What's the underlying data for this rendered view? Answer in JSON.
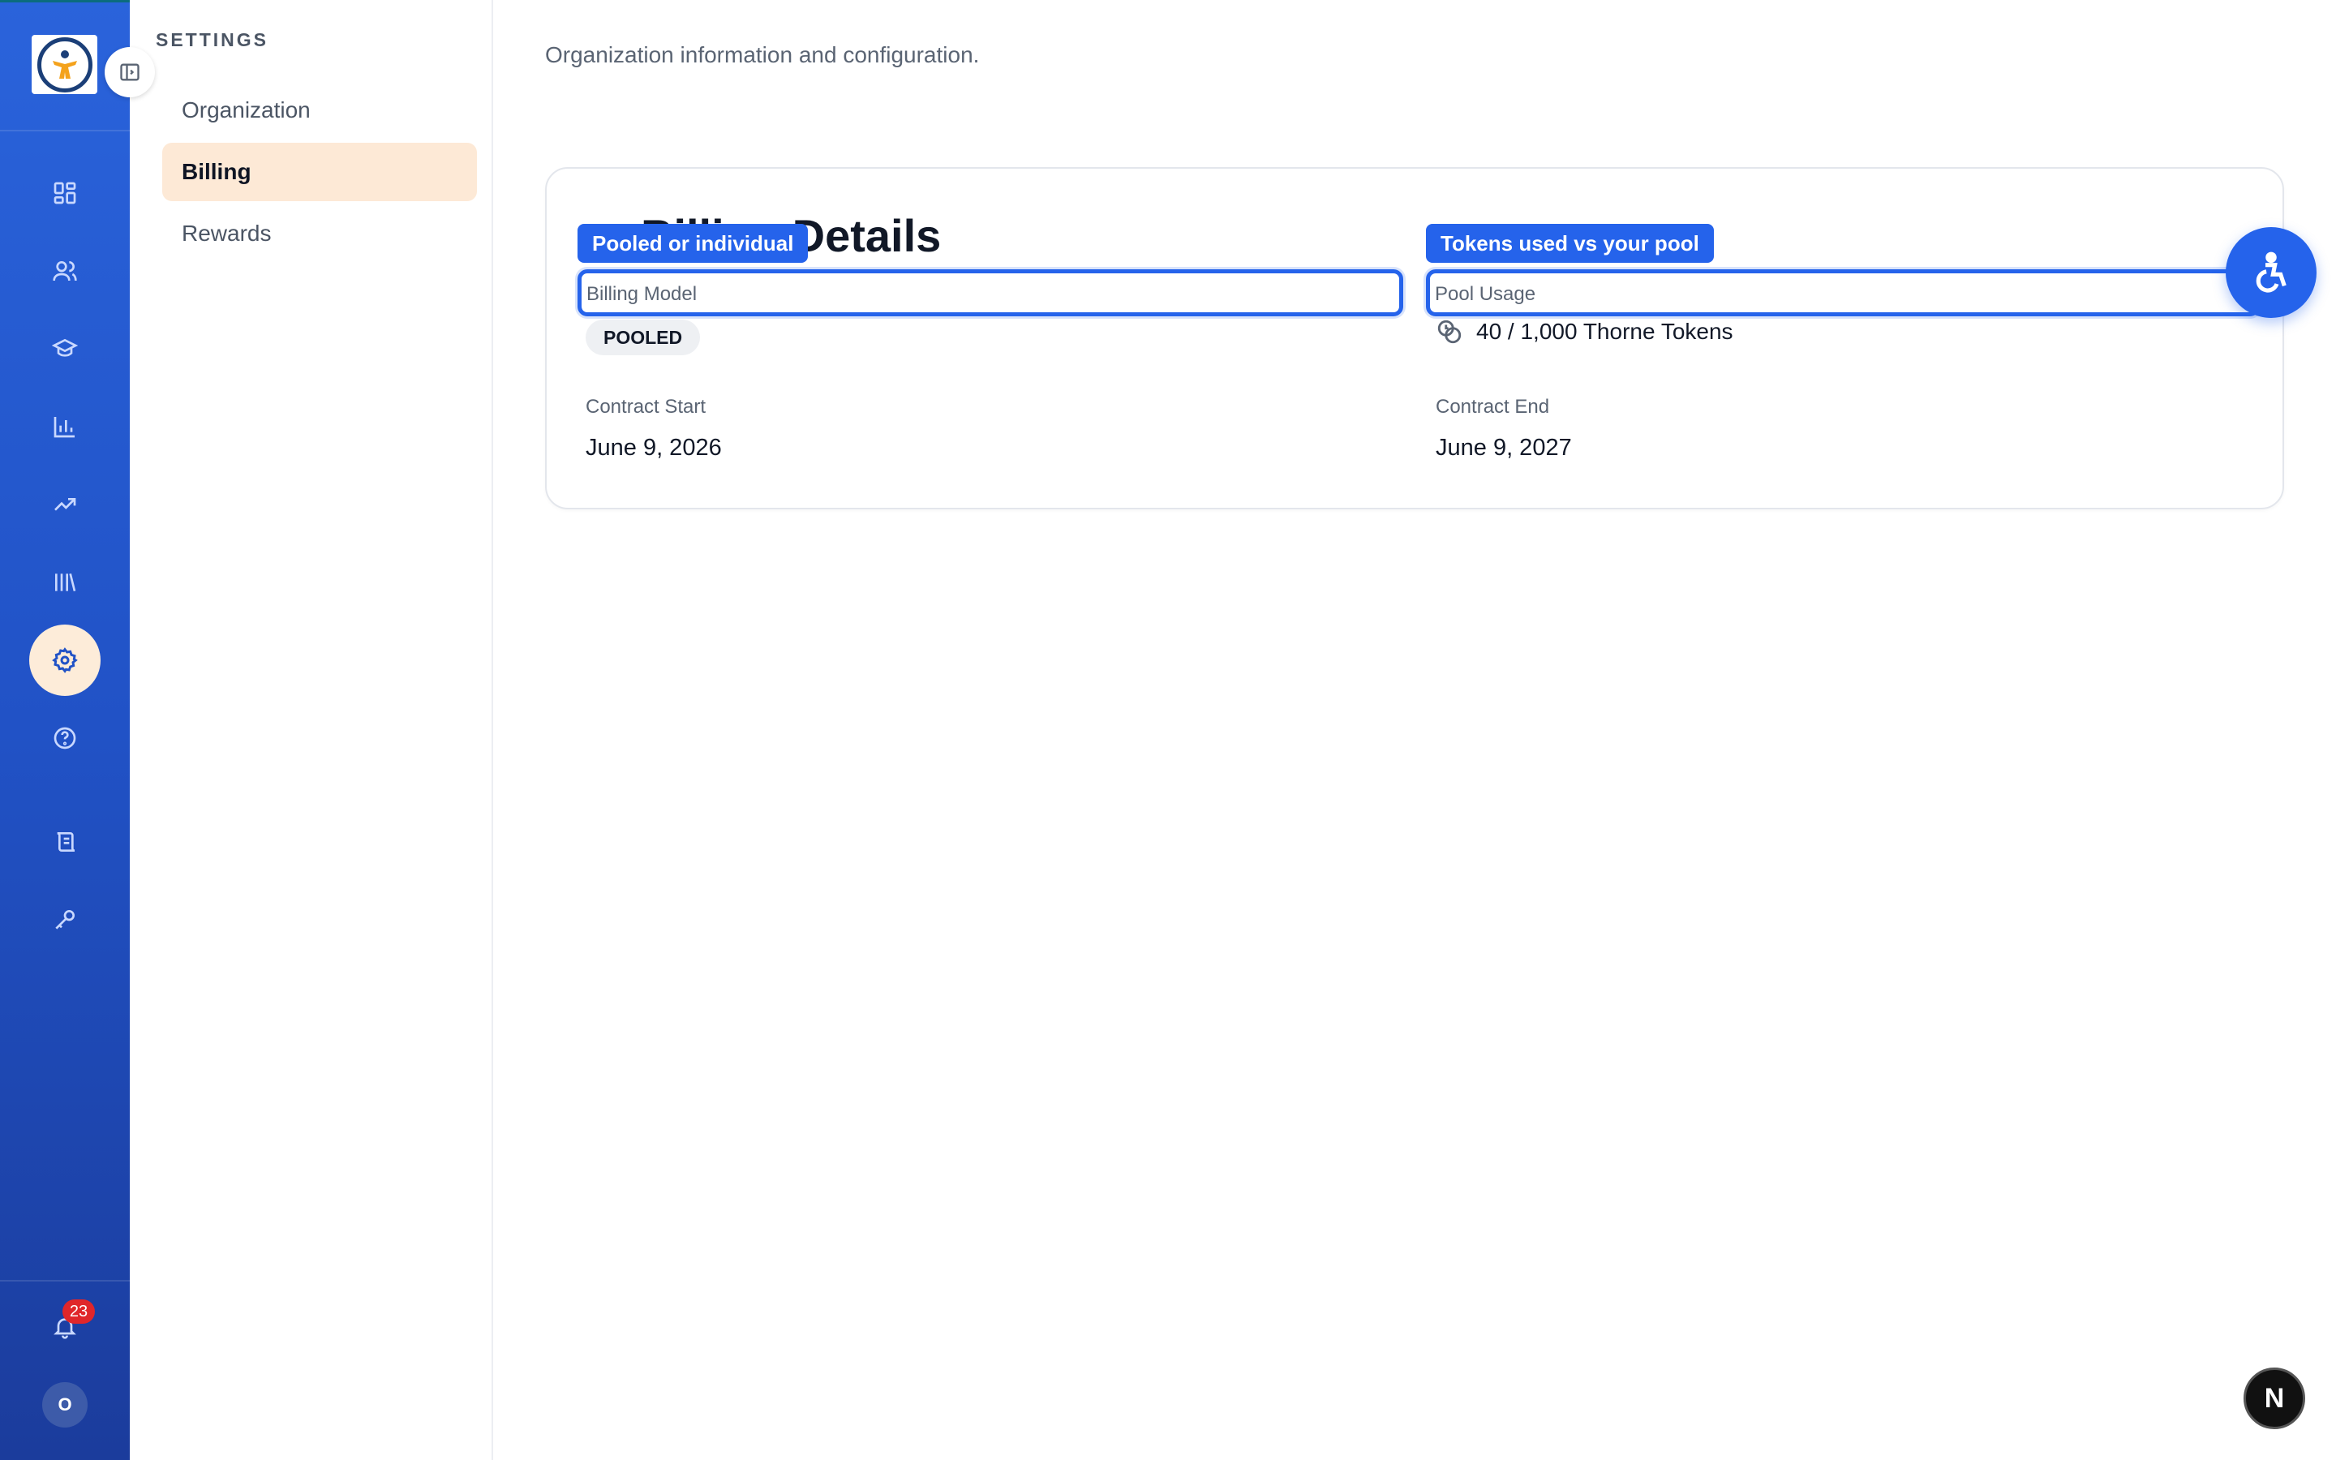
{
  "rail": {
    "icons": [
      "dashboard-icon",
      "users-icon",
      "graduation-cap-icon",
      "bar-chart-icon",
      "trending-up-icon",
      "library-icon",
      "settings-icon",
      "help-icon",
      "scroll-icon",
      "key-icon"
    ],
    "notifications_count": "23",
    "avatar_initial": "O",
    "colors": {
      "rail_top": "#2a63db",
      "rail_bottom": "#1b3c9c",
      "active_bg": "#fdecd9"
    }
  },
  "sidebar": {
    "title": "SETTINGS",
    "items": [
      {
        "label": "Organization",
        "active": false
      },
      {
        "label": "Billing",
        "active": true
      },
      {
        "label": "Rewards",
        "active": false
      }
    ]
  },
  "main": {
    "subtitle": "Organization information and configuration.",
    "card": {
      "title": "Billing Details",
      "billing_model": {
        "label": "Billing Model",
        "value": "POOLED",
        "tooltip": "Pooled or individual"
      },
      "pool_usage": {
        "label": "Pool Usage",
        "value": "40 / 1,000 Thorne Tokens",
        "tooltip": "Tokens used vs your pool"
      },
      "contract_start": {
        "label": "Contract Start",
        "value": "June 9, 2026"
      },
      "contract_end": {
        "label": "Contract End",
        "value": "June 9, 2027"
      }
    }
  },
  "floating": {
    "next_badge": "N"
  }
}
